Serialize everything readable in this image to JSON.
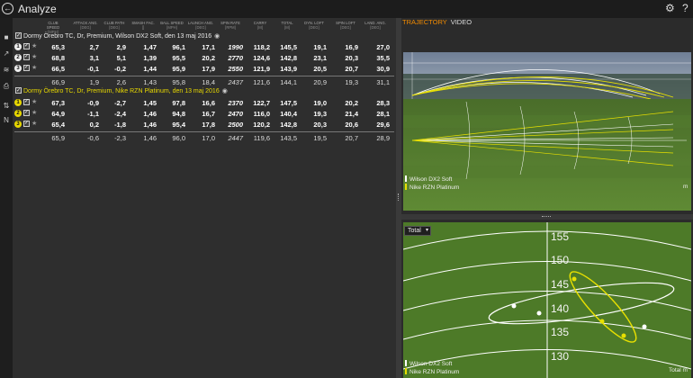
{
  "app": {
    "title": "Analyze"
  },
  "toolbar": {
    "back_icon": "←",
    "settings_icon": "⚙",
    "help_icon": "?"
  },
  "tools": [
    "■",
    "↗",
    "≋",
    "⎙",
    "⇅",
    "N"
  ],
  "columns": [
    {
      "label": "CLUB SPEED",
      "unit": "[mph]"
    },
    {
      "label": "ATTACK ANG.",
      "unit": "[deg]"
    },
    {
      "label": "CLUB PATH",
      "unit": "[deg]"
    },
    {
      "label": "SMASH FAC.",
      "unit": "[]"
    },
    {
      "label": "BALL SPEED",
      "unit": "[mph]"
    },
    {
      "label": "LAUNCH ANG.",
      "unit": "[deg]"
    },
    {
      "label": "SPIN RATE",
      "unit": "[rpm]"
    },
    {
      "label": "CARRY",
      "unit": "[m]"
    },
    {
      "label": "TOTAL",
      "unit": "[m]"
    },
    {
      "label": "DYN. LOFT",
      "unit": "[deg]"
    },
    {
      "label": "SPIN LOFT",
      "unit": "[deg]"
    },
    {
      "label": "LAND. ANG.",
      "unit": "[deg]"
    }
  ],
  "groups": [
    {
      "title": "Dormy Örebro TC, Dr, Premium, Wilson DX2 Soft, den 13 maj 2016",
      "shots": [
        {
          "n": "1",
          "values": [
            "65,3",
            "2,7",
            "2,9",
            "1,47",
            "96,1",
            "17,1",
            "1990",
            "118,2",
            "145,5",
            "19,1",
            "16,9",
            "27,0"
          ]
        },
        {
          "n": "2",
          "values": [
            "68,8",
            "3,1",
            "5,1",
            "1,39",
            "95,5",
            "20,2",
            "2770",
            "124,6",
            "142,8",
            "23,1",
            "20,3",
            "35,5"
          ]
        },
        {
          "n": "3",
          "values": [
            "66,5",
            "-0,1",
            "-0,2",
            "1,44",
            "95,9",
            "17,9",
            "2550",
            "121,9",
            "143,9",
            "20,5",
            "20,7",
            "30,9"
          ]
        }
      ],
      "average": [
        "66,9",
        "1,9",
        "2,6",
        "1,43",
        "95,8",
        "18,4",
        "2437",
        "121,6",
        "144,1",
        "20,9",
        "19,3",
        "31,1"
      ]
    },
    {
      "title": "Dormy Örebro TC, Dr, Premium, Nike RZN Platinum, den 13 maj 2016",
      "shots": [
        {
          "n": "1",
          "values": [
            "67,3",
            "-0,9",
            "-2,7",
            "1,45",
            "97,8",
            "16,6",
            "2370",
            "122,7",
            "147,5",
            "19,0",
            "20,2",
            "28,3"
          ]
        },
        {
          "n": "2",
          "values": [
            "64,9",
            "-1,1",
            "-2,4",
            "1,46",
            "94,8",
            "16,7",
            "2470",
            "116,0",
            "140,4",
            "19,3",
            "21,4",
            "28,1"
          ]
        },
        {
          "n": "3",
          "values": [
            "65,4",
            "0,2",
            "-1,8",
            "1,46",
            "95,4",
            "17,8",
            "2500",
            "120,2",
            "142,8",
            "20,3",
            "20,6",
            "29,6"
          ]
        }
      ],
      "average": [
        "65,9",
        "-0,6",
        "-2,3",
        "1,46",
        "96,0",
        "17,0",
        "2447",
        "119,6",
        "143,5",
        "19,5",
        "20,7",
        "28,9"
      ]
    }
  ],
  "right": {
    "tabs": {
      "active": "TRAJECTORY",
      "inactive": "VIDEO"
    },
    "legend": [
      {
        "name": "Wilson DX2 Soft",
        "color": "#ffffff"
      },
      {
        "name": "Nike RZN Platinum",
        "color": "#e8e000"
      }
    ],
    "unit": "m",
    "dispersion": {
      "select_value": "Total",
      "ticks": [
        "155",
        "150",
        "145",
        "140",
        "135",
        "130"
      ],
      "unit_label": "Total m"
    }
  },
  "colors": {
    "accent": "#f08a00",
    "yellow": "#e8d800",
    "fairway": "#4d7a28"
  }
}
